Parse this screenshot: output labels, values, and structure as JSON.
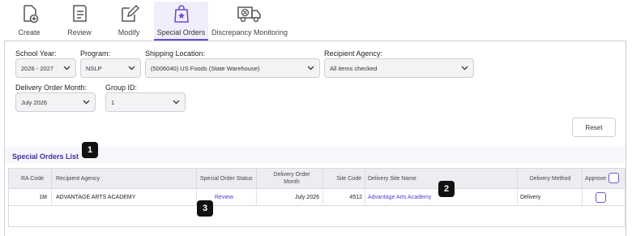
{
  "toolbar": {
    "create": "Create",
    "review": "Review",
    "modify": "Modify",
    "special_orders": "Special Orders",
    "discrepancy": "Discrepancy Monitoring"
  },
  "filters": {
    "school_year_label": "School Year:",
    "school_year_value": "2026 - 2027",
    "program_label": "Program:",
    "program_value": "NSLP",
    "shipping_label": "Shipping Location:",
    "shipping_value": "(5006040) US Foods (State Warehouse)",
    "recipient_label": "Recipient Agency:",
    "recipient_value": "All items checked",
    "delivery_month_label": "Delivery Order Month:",
    "delivery_month_value": "July 2026",
    "group_label": "Group ID:",
    "group_value": "1",
    "reset_label": "Reset"
  },
  "list": {
    "title": "Special Orders List",
    "headers": {
      "ra_code": "RA Code",
      "recipient_agency": "Recipient Agency",
      "status": "Special Order Status",
      "delivery_month_1": "Delivery Order",
      "delivery_month_2": "Month",
      "site_code": "Site Code",
      "site_name": "Delivery Site Name",
      "method": "Delivery Method",
      "approve": "Approve"
    },
    "rows": [
      {
        "ra_code": "1M",
        "recipient_agency": "ADVANTAGE ARTS ACADEMY",
        "status": "Review",
        "delivery_month": "July 2026",
        "site_code": "4512",
        "site_name": "Advantage Arts Academy",
        "method": "Delivery"
      }
    ]
  },
  "badges": [
    "1",
    "2",
    "3"
  ],
  "colors": {
    "accent": "#6a4fd0",
    "link": "#4a3fc8",
    "title": "#3f2fa0"
  }
}
